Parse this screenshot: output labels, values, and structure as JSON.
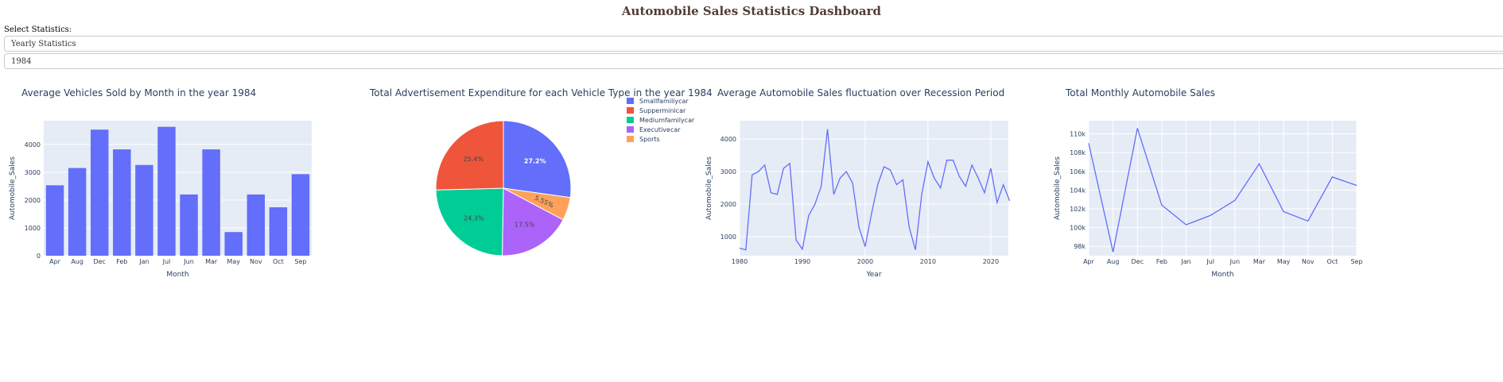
{
  "dashboard": {
    "title": "Automobile Sales Statistics Dashboard",
    "select_label": "Select Statistics:",
    "statistics_dropdown": {
      "selected": "Yearly Statistics"
    },
    "year_dropdown": {
      "selected": "1984"
    }
  },
  "colors": {
    "plot_bg": "#E5ECF6",
    "primary": "#636EFA",
    "axis_text": "#2a3f5f"
  },
  "chart_data": [
    {
      "type": "bar",
      "title": "Average Vehicles Sold by Month in the year 1984",
      "xlabel": "Month",
      "ylabel": "Automobile_Sales",
      "categories": [
        "Apr",
        "Aug",
        "Dec",
        "Feb",
        "Jan",
        "Jul",
        "Jun",
        "Mar",
        "May",
        "Nov",
        "Oct",
        "Sep"
      ],
      "values": [
        2530,
        3150,
        4530,
        3820,
        3260,
        4630,
        2200,
        3820,
        850,
        2200,
        1740,
        2930
      ],
      "ylim": [
        0,
        4850
      ],
      "yticks": [
        0,
        1000,
        2000,
        3000,
        4000
      ],
      "color": "#636EFA"
    },
    {
      "type": "pie",
      "title": "Total Advertisement Expenditure for each Vehicle Type in the year 1984",
      "slices": [
        {
          "name": "Smallfamiliycar",
          "value": 27.2,
          "label": "27.2%",
          "color": "#636EFA"
        },
        {
          "name": "Sports",
          "value": 5.55,
          "label": "5.55%",
          "color": "#FFA15A"
        },
        {
          "name": "Executivecar",
          "value": 17.5,
          "label": "17.5%",
          "color": "#AB63FA"
        },
        {
          "name": "Mediumfamilycar",
          "value": 24.3,
          "label": "24.3%",
          "color": "#00CC96"
        },
        {
          "name": "Supperminicar",
          "value": 25.4,
          "label": "25.4%",
          "color": "#EF553B"
        }
      ],
      "legend": [
        "Smallfamiliycar",
        "Supperminicar",
        "Mediumfamilycar",
        "Executivecar",
        "Sports"
      ],
      "legend_colors": [
        "#636EFA",
        "#EF553B",
        "#00CC96",
        "#AB63FA",
        "#FFA15A"
      ],
      "legend_position": "right"
    },
    {
      "type": "line",
      "title": "Average Automobile Sales fluctuation over Recession Period",
      "xlabel": "Year",
      "ylabel": "Automobile_Sales",
      "x": [
        1980,
        1981,
        1982,
        1983,
        1984,
        1985,
        1986,
        1987,
        1988,
        1989,
        1990,
        1991,
        1992,
        1993,
        1994,
        1995,
        1996,
        1997,
        1998,
        1999,
        2000,
        2001,
        2002,
        2003,
        2004,
        2005,
        2006,
        2007,
        2008,
        2009,
        2010,
        2011,
        2012,
        2013,
        2014,
        2015,
        2016,
        2017,
        2018,
        2019,
        2020,
        2021,
        2022,
        2023
      ],
      "y": [
        650,
        600,
        2900,
        3000,
        3200,
        2350,
        2300,
        3100,
        3250,
        900,
        620,
        1650,
        2000,
        2550,
        4300,
        2300,
        2800,
        3000,
        2650,
        1300,
        700,
        1700,
        2600,
        3150,
        3050,
        2600,
        2750,
        1300,
        600,
        2300,
        3300,
        2800,
        2500,
        3350,
        3350,
        2850,
        2550,
        3200,
        2800,
        2350,
        3100,
        2050,
        2600,
        2100
      ],
      "xlim": [
        1980,
        2022.8
      ],
      "ylim": [
        420,
        4560
      ],
      "xticks": [
        1980,
        1990,
        2000,
        2010,
        2020
      ],
      "yticks": [
        1000,
        2000,
        3000,
        4000
      ],
      "color": "#636EFA"
    },
    {
      "type": "line",
      "title": "Total Monthly Automobile Sales",
      "xlabel": "Month",
      "ylabel": "Automobile_Sales",
      "categories": [
        "Apr",
        "Aug",
        "Dec",
        "Feb",
        "Jan",
        "Jul",
        "Jun",
        "Mar",
        "May",
        "Nov",
        "Oct",
        "Sep"
      ],
      "values": [
        109000,
        97400,
        110600,
        102400,
        100300,
        101300,
        102900,
        106800,
        101700,
        100700,
        105400,
        104500
      ],
      "ylim": [
        97000,
        111400
      ],
      "yticks": [
        98000,
        100000,
        102000,
        104000,
        106000,
        108000,
        110000
      ],
      "ytick_labels": [
        "98k",
        "100k",
        "102k",
        "104k",
        "106k",
        "108k",
        "110k"
      ],
      "color": "#636EFA"
    }
  ]
}
